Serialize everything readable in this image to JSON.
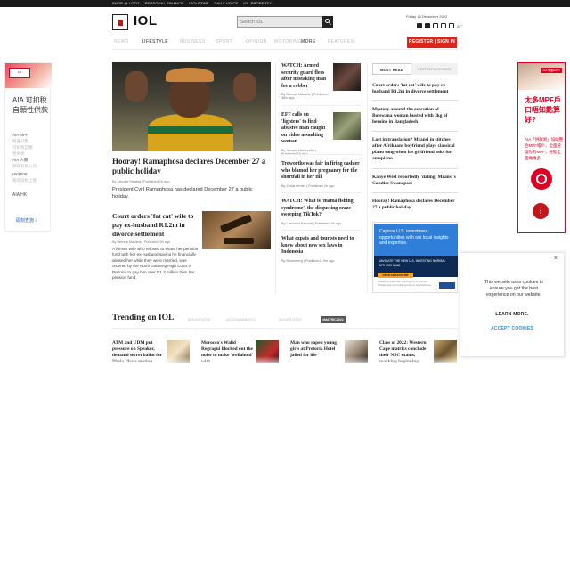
{
  "topbar": {
    "links": [
      "SHOP @ LOOT",
      "PERSONAL FINANCE",
      "ISOLEZWE",
      "DAILY VOICE",
      "IOL PROPERTY"
    ]
  },
  "header": {
    "logo_text": "IOL",
    "search_placeholder": "Search IOL",
    "date_line": "Friday 16 December 2022",
    "weather": "22°"
  },
  "nav": {
    "items": [
      "NEWS",
      "LIFESTYLE",
      "BUSINESS",
      "SPORT",
      "OPINION",
      "MOTORING",
      "MORE",
      "FEATURES"
    ],
    "active_index": 1,
    "register_label": "REGISTER | SIGN IN"
  },
  "left_ad": {
    "badge": "AIA",
    "title": "AIA 可扣稅自願性供款",
    "lines": [
      "AIA MPF",
      "特選計劃",
      "可扣稅自願",
      "性供款",
      "AIA 人壽",
      "保險有限公司",
      "HK$60K",
      "每年扣稅上限"
    ],
    "cta": "即刻查詢 >"
  },
  "right_ad": {
    "corner": "AIA 專業EASY",
    "headline": "太多MPF戶口唔知點算好?",
    "body": "AIA「供款易」協助整合MPF帳戶，全面管理你的MPF，輕鬆全面做更多"
  },
  "hero": {
    "title": "Hooray! Ramaphosa declares December 27 a public holiday",
    "byline": "By Jabulile Mbatha | Published 1h ago",
    "summary": "President Cyril Ramaphosa has declared December 27 a public holiday."
  },
  "court": {
    "title": "Court orders 'fat cat' wife to pay ex-husband R1.2m in divorce settlement",
    "byline": "By Brenda Masilela | Published 5h ago",
    "summary": "A former wife who refused to share her pension fund with her ex-husband saying he financially abused her while they were married, was ordered by the North Gauteng High Court in Pretoria to pay him over R1.2 million from her pension fund."
  },
  "mid_stories": [
    {
      "title": "WATCH: Armed security guard flees after mistaking man for a robber",
      "byline": "By Brenda Masilela | Published 38m ago"
    },
    {
      "title": "EFF calls on 'lighters' to find abusive man caught on video assaulting woman",
      "byline": "By Jehaan Marimuthu | Published 1h ago"
    },
    {
      "title": "Troworths was fair in firing cashier who blamed her pregnancy for the shortfall in her till",
      "byline": "By Zelda Venter | Published 4h ago"
    },
    {
      "title": "WATCH: What is 'mama fishing syndrome', the disgusting craze sweeping TikTok?",
      "byline": "By Lerushka Bisnath | Published 6h ago"
    },
    {
      "title": "What expats and tourists need to know about new sex laws in Indonesia",
      "byline": "By Bloomberg | Published 19m ago"
    }
  ],
  "most_read": {
    "tab_on": "MOST READ",
    "tab_off": "EDITOR'S CHOICE",
    "items": [
      "Court orders 'fat cat' wife to pay ex-husband R1.2m in divorce settlement",
      "Mystery around the execution of Botswana woman busted with 3kg of heroine in Bangladesh",
      "Lost in translation? Mzansi in stitches after Afrikaans boyfriend plays classical piano song when his girlfriend asks for amapiano",
      "Kanye West reportedly 'dating' Mzansi's Candice Swanepoel",
      "Hooray! Ramaphosa declares December 27 a public holiday"
    ]
  },
  "invest_ad": {
    "headline": "Capture U.S. investment opportunities with our local insights and expertise.",
    "sub": "NAVIGATE THE NEW U.S. INVESTING NORMAL WITH SCHWAB",
    "button": "OPEN AN ACCOUNT",
    "fine": "Investing involves risk, including loss of principal. Schwab does not provide services in all jurisdictions."
  },
  "trending": {
    "heading": "Trending on IOL",
    "tabs": [
      "#DEVASTATED",
      "#ZODWAWABANTU",
      "#GOATSTATUS",
      "#MATRIC2022"
    ],
    "active_index": 3,
    "items": [
      "ATM and UDM put pressure on Speaker, demand secret ballot for Phala Phala motion",
      "Morocco's Walid Regragui blocked out the noise to make 'wellahoid' with",
      "Man who raped young girls at Pretoria Hotel jailed for life",
      "Class of 2022: Western Cape matrics conclude their NSC exams, marking beginning"
    ]
  },
  "cookie": {
    "message": "This website uses cookies to ensure you get the best experience on our website.",
    "learn": "LEARN MORE.",
    "accept": "ACCEPT COOKIES",
    "close": "×"
  }
}
